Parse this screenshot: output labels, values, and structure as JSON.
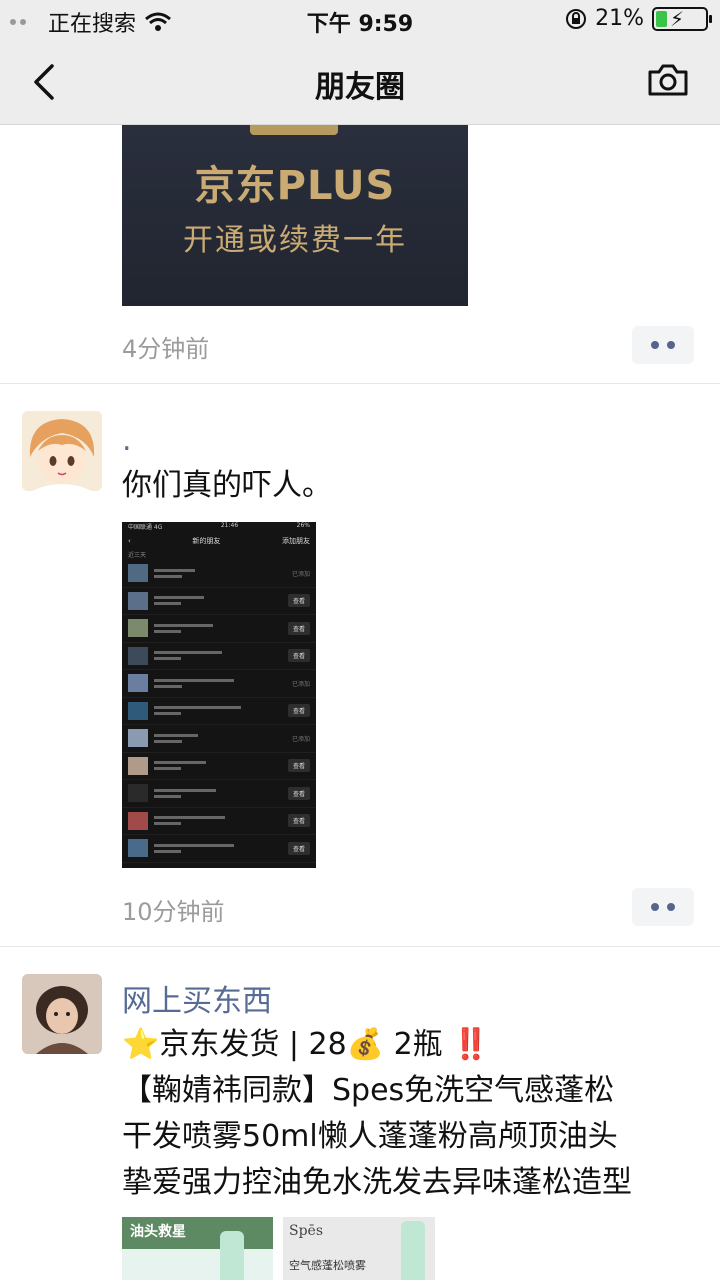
{
  "status_bar": {
    "carrier": "正在搜索",
    "time": "下午 9:59",
    "battery": "21%",
    "battery_level": 0.21
  },
  "nav": {
    "title": "朋友圈"
  },
  "posts": [
    {
      "image_title": "京东PLUS",
      "image_subtitle": "开通或续费一年",
      "time": "4分钟前"
    },
    {
      "name": ".",
      "text": "你们真的吓人。",
      "time": "10分钟前",
      "screenshot": {
        "status_left": "中国联通 4G",
        "status_time": "21:46",
        "status_right": "26%",
        "title": "新的朋友",
        "action": "添加朋友",
        "section": "近三天",
        "rows": [
          "已添加",
          "查看",
          "查看",
          "查看",
          "已添加",
          "查看",
          "已添加",
          "查看",
          "查看",
          "查看",
          "查看"
        ]
      }
    },
    {
      "name": "网上买东西",
      "line1": "⭐京东发货 | 28💰 2瓶 ‼️",
      "line2": "【鞠婧祎同款】Spes免洗空气感蓬松",
      "line3": "干发喷雾50ml懒人蓬蓬粉高颅顶油头",
      "line4": "挚爱强力控油免水洗发去异味蓬松造型",
      "thumb1_text": "油头救星",
      "thumb2_brand": "Spēs",
      "thumb2_caption": "空气感蓬松喷雾"
    }
  ]
}
